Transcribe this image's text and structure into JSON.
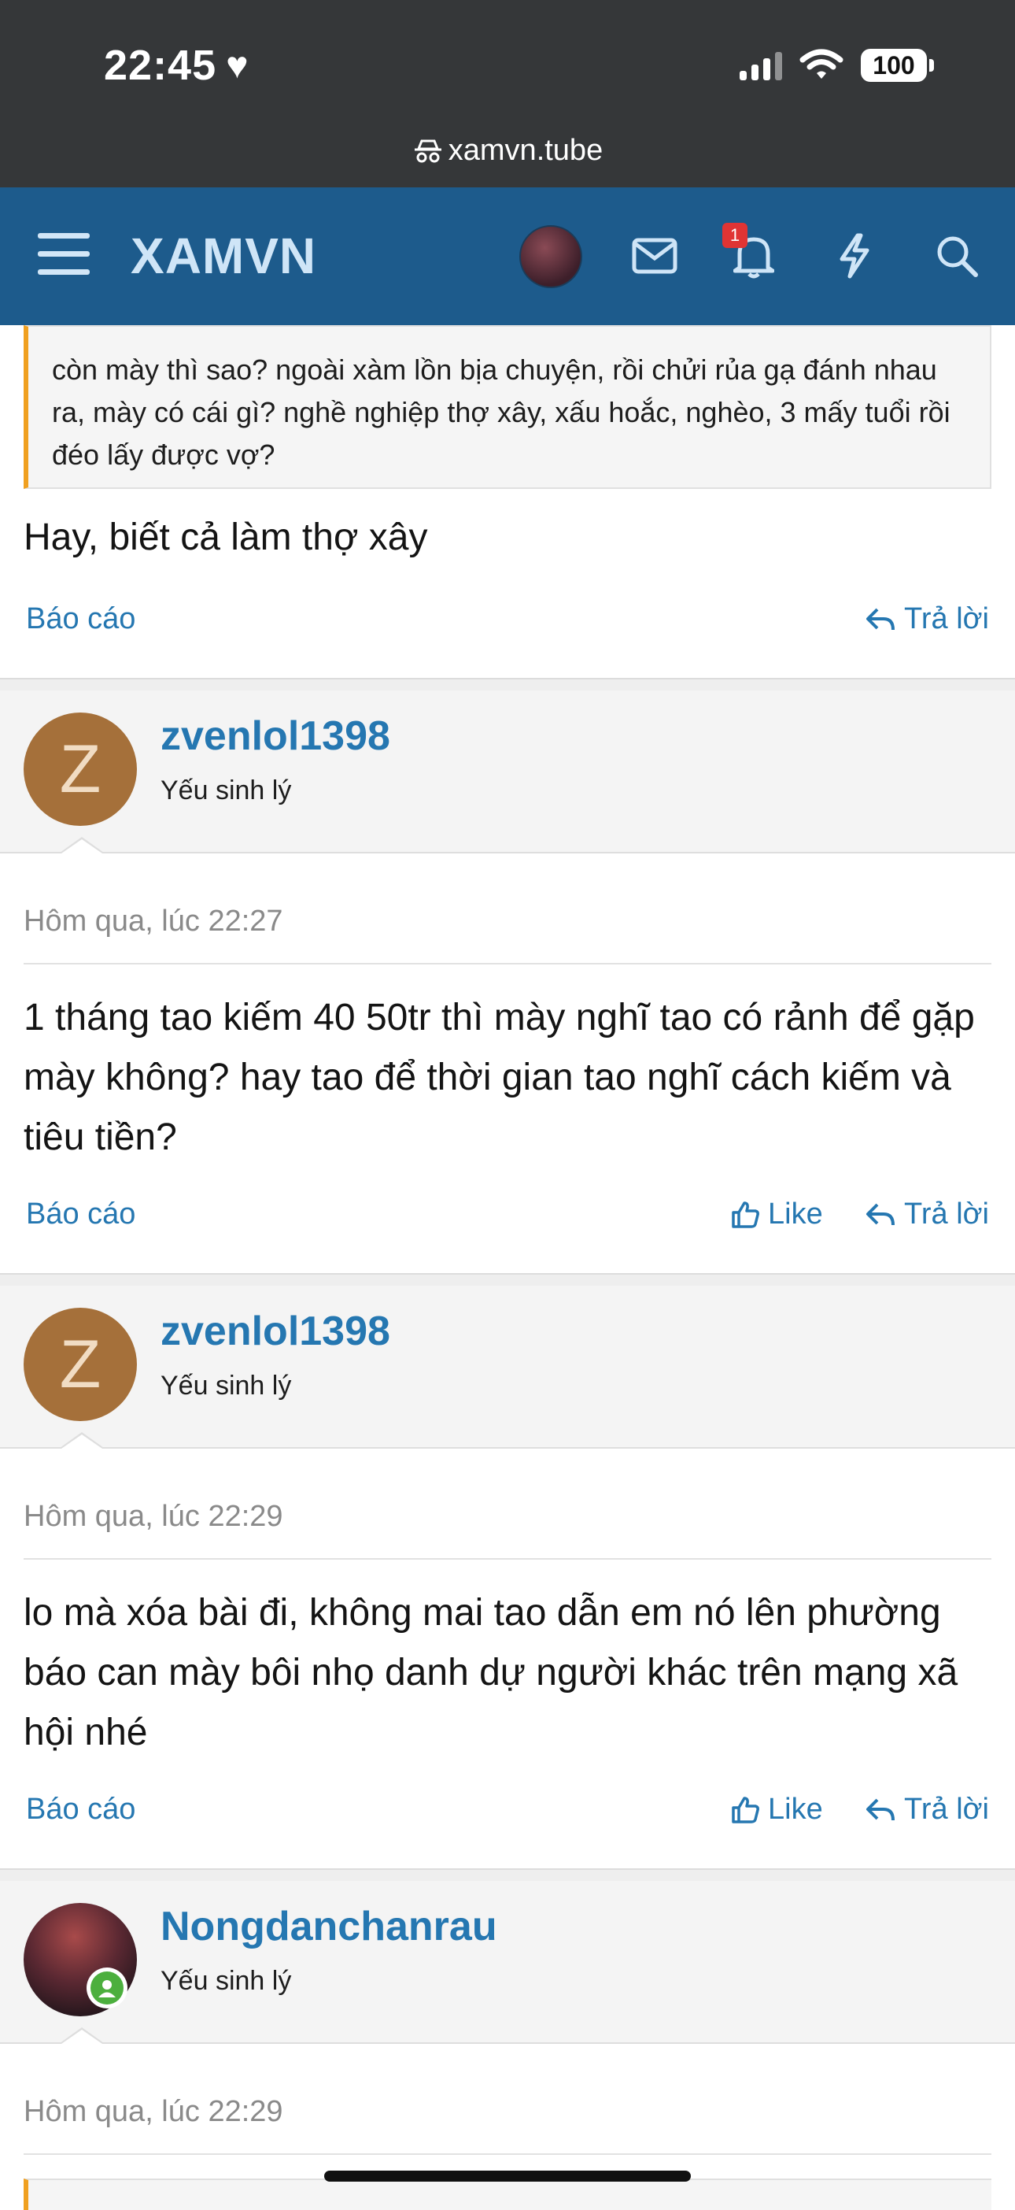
{
  "status_bar": {
    "time": "22:45",
    "battery": "100"
  },
  "url_bar": {
    "domain": "xamvn.tube"
  },
  "header": {
    "logo": "XAMVN",
    "notification_count": "1"
  },
  "quote": {
    "text": "còn mày thì sao? ngoài xàm lồn bịa chuyện, rồi chửi rủa gạ đánh nhau ra, mày có cái gì? nghề nghiệp thợ xây, xấu hoắc, nghèo, 3 mấy tuổi rồi đéo lấy được vợ?"
  },
  "first_post": {
    "text": "Hay, biết cả làm thợ xây",
    "report": "Báo cáo",
    "reply": "Trả lời"
  },
  "posts": [
    {
      "username": "zvenlol1398",
      "avatar_letter": "Z",
      "user_title": "Yếu sinh lý",
      "date": "Hôm qua, lúc 22:27",
      "text": "1 tháng tao kiếm 40 50tr thì mày nghĩ tao có rảnh để gặp mày không? hay tao để thời gian tao nghĩ cách kiếm và tiêu tiền?",
      "report": "Báo cáo",
      "like": "Like",
      "reply": "Trả lời"
    },
    {
      "username": "zvenlol1398",
      "avatar_letter": "Z",
      "user_title": "Yếu sinh lý",
      "date": "Hôm qua, lúc 22:29",
      "text": "lo mà xóa bài đi, không mai tao dẫn em nó lên phường báo can mày bôi nhọ danh dự người khác trên mạng xã hội nhé",
      "report": "Báo cáo",
      "like": "Like",
      "reply": "Trả lời"
    },
    {
      "username": "Nongdanchanrau",
      "user_title": "Yếu sinh lý",
      "date": "Hôm qua, lúc 22:29"
    }
  ],
  "colors": {
    "header_bg": "#1d5b8c",
    "link": "#2577b1",
    "avatar_z": "#a5703a",
    "quote_border": "#f0a020",
    "badge": "#e03434"
  }
}
